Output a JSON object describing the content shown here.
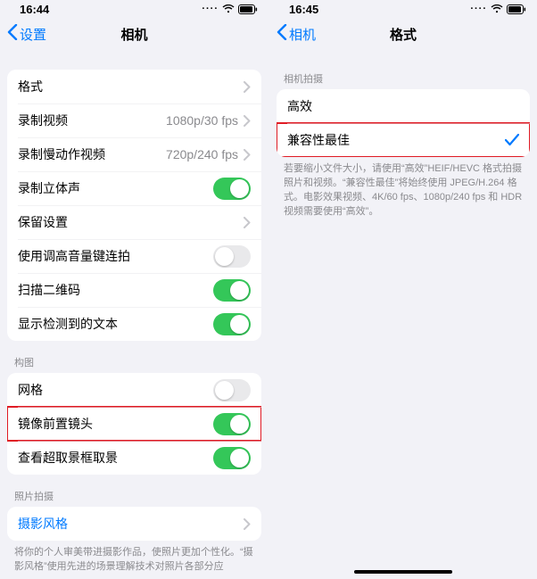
{
  "left": {
    "status_time": "16:44",
    "back_label": "设置",
    "title": "相机",
    "group1": [
      {
        "label": "格式",
        "type": "disclosure"
      },
      {
        "label": "录制视频",
        "detail": "1080p/30 fps",
        "type": "disclosure"
      },
      {
        "label": "录制慢动作视频",
        "detail": "720p/240 fps",
        "type": "disclosure"
      },
      {
        "label": "录制立体声",
        "type": "toggle",
        "on": true
      },
      {
        "label": "保留设置",
        "type": "disclosure"
      },
      {
        "label": "使用调高音量键连拍",
        "type": "toggle",
        "on": false
      },
      {
        "label": "扫描二维码",
        "type": "toggle",
        "on": true
      },
      {
        "label": "显示检测到的文本",
        "type": "toggle",
        "on": true
      }
    ],
    "group2_header": "构图",
    "group2": [
      {
        "label": "网格",
        "type": "toggle",
        "on": false
      },
      {
        "label": "镜像前置镜头",
        "type": "toggle",
        "on": true,
        "highlight": true
      },
      {
        "label": "查看超取景框取景",
        "type": "toggle",
        "on": true
      }
    ],
    "group3_header": "照片拍摄",
    "group3": [
      {
        "label": "摄影风格",
        "type": "link"
      }
    ],
    "group3_footer": "将你的个人审美带进摄影作品，使照片更加个性化。“摄影风格”使用先进的场景理解技术对照片各部分应"
  },
  "right": {
    "status_time": "16:45",
    "back_label": "相机",
    "title": "格式",
    "group1_header": "相机拍摄",
    "group1": [
      {
        "label": "高效",
        "checked": false
      },
      {
        "label": "兼容性最佳",
        "checked": true,
        "highlight": true
      }
    ],
    "group1_footer": "若要缩小文件大小，请使用“高效”HEIF/HEVC 格式拍摄照片和视频。“兼容性最佳”将始终使用 JPEG/H.264 格式。电影效果视频、4K/60 fps、1080p/240 fps 和 HDR 视频需要使用“高效”。"
  }
}
